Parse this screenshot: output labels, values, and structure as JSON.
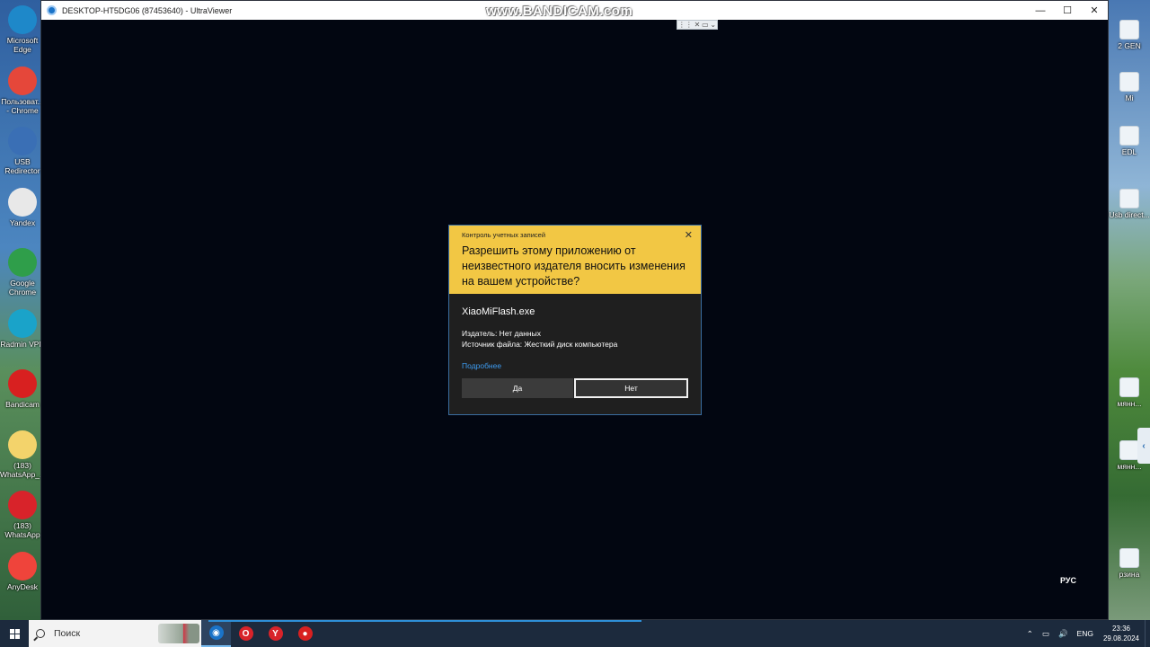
{
  "desktop_left": [
    {
      "label": "Microsoft\nEdge",
      "icon": "edge-icon",
      "color": "#1e88c9"
    },
    {
      "label": "Пользоват...\n- Chrome",
      "icon": "chrome-icon",
      "color": "#e5473a"
    },
    {
      "label": "USB\nRedirector",
      "icon": "usb-redirector-icon",
      "color": "#3a6fb5"
    },
    {
      "label": "Yandex",
      "icon": "yandex-icon",
      "color": "#e8e8e8"
    },
    {
      "label": "Google\nChrome",
      "icon": "chrome-icon",
      "color": "#2f9e4a"
    },
    {
      "label": "Radmin VPN",
      "icon": "radmin-vpn-icon",
      "color": "#1aa3c9"
    },
    {
      "label": "Bandicam",
      "icon": "bandicam-icon",
      "color": "#d82020"
    },
    {
      "label": "(183)\nWhatsApp_...",
      "icon": "folder-icon",
      "color": "#f3d36b"
    },
    {
      "label": "(183)\nWhatsApp",
      "icon": "opera-icon",
      "color": "#d8232a"
    },
    {
      "label": "AnyDesk",
      "icon": "anydesk-icon",
      "color": "#ef443b"
    }
  ],
  "desktop_right": [
    {
      "label": "2 GEN"
    },
    {
      "label": "Mi"
    },
    {
      "label": "EDL"
    },
    {
      "label": "Usb\ndirect..."
    },
    {
      "label": "мянн..."
    },
    {
      "label": "мянн..."
    },
    {
      "label": "рзина"
    }
  ],
  "window": {
    "title": "DESKTOP-HT5DG06 (87453640) - UltraViewer",
    "watermark": "www.BANDICAM.com",
    "minimize": "—",
    "maximize": "☐",
    "close": "✕"
  },
  "toolbar": {
    "grip": "⋮⋮",
    "close": "✕",
    "screen": "▭",
    "chevron": "⌄"
  },
  "remote_lang": "РУС",
  "uac": {
    "caption": "Контроль учетных записей",
    "close": "✕",
    "question": "Разрешить этому приложению от неизвестного издателя вносить изменения на вашем устройстве?",
    "app_name": "XiaoMiFlash.exe",
    "publisher": "Издатель: Нет данных",
    "source": "Источник файла: Жесткий диск компьютера",
    "more": "Подробнее",
    "yes": "Да",
    "no": "Нет"
  },
  "edge_tab": "‹",
  "taskbar": {
    "search_placeholder": "Поиск",
    "apps": [
      {
        "name": "ultraviewer",
        "glyph": "◉",
        "color": "#1a73c8",
        "active": true
      },
      {
        "name": "opera",
        "glyph": "O",
        "color": "#d8232a",
        "active": false
      },
      {
        "name": "yandex",
        "glyph": "Y",
        "color": "#d8232a",
        "active": false
      },
      {
        "name": "bandicam",
        "glyph": "●",
        "color": "#d82020",
        "active": false
      }
    ],
    "tray": {
      "chevron": "⌃",
      "network": "▭",
      "volume": "🔊",
      "lang": "ENG",
      "time": "23:36",
      "date": "29.08.2024"
    }
  }
}
